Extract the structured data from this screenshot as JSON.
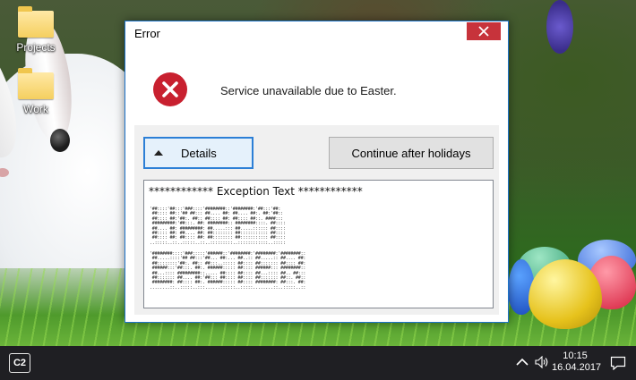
{
  "desktop": {
    "icons": [
      {
        "label": "Projects"
      },
      {
        "label": "Work"
      }
    ]
  },
  "dialog": {
    "title": "Error",
    "message": "Service unavailable due to Easter.",
    "details_button": "Details",
    "continue_button": "Continue after holidays",
    "exception_title": "************ Exception Text ************",
    "ascii_art": [
      "'##::::'##:::'###::::'########::'########:'##:::'##:\n ##:::: ##::'## ##::: ##.... ##: ##.... ##:. ##:'##::\n ##:::: ##:'##:. ##:: ##:::: ##: ##:::: ##::. ####:::\n #########:'##:::. ##: ########:: ########::::. ##::::\n ##.... ##: #########: ##.....::: ##.....:::::: ##::::\n ##:::: ##: ##.... ##: ##:::::::: ##::::::::::: ##::::\n ##:::: ##: ##:::: ##: ##:::::::: ##::::::::::: ##::::\n..:::::..::..:::::..::..:::::::::..::::::::::::..:::::",
      "'########::::'###:::::'######::'########:'########:'########::\n ##.....::::'## ##:::'##... ##:... ##..:: ##.....:: ##.... ##:\n ##::::::::'##:. ##:: ##:::..::::: ##:::: ##::::::: ##:::: ##:\n ######:::'##:::. ##:. ######::::: ##:::: ######::: ########::\n ##...:::: #########::..... ##:::: ##:::: ##...:::: ##.. ##:::\n ##::::::: ##.... ##:'##::: ##:::: ##:::: ##::::::: ##::. ##::\n ########: ##:::: ##:. ######::::: ##:::: ########: ##:::. ##:\n........::..:::::..:::......::::::..:::::........::..:::::..::"
    ]
  },
  "taskbar": {
    "start_label": "C2",
    "time": "10:15",
    "date": "16.04.2017",
    "icons": [
      "chevron-up-icon",
      "speaker-icon",
      "notification-icon"
    ]
  },
  "colors": {
    "accent": "#2c7fd6",
    "close_red": "#c7333b",
    "error_red": "#c8202f",
    "taskbar": "#1f1f23"
  }
}
